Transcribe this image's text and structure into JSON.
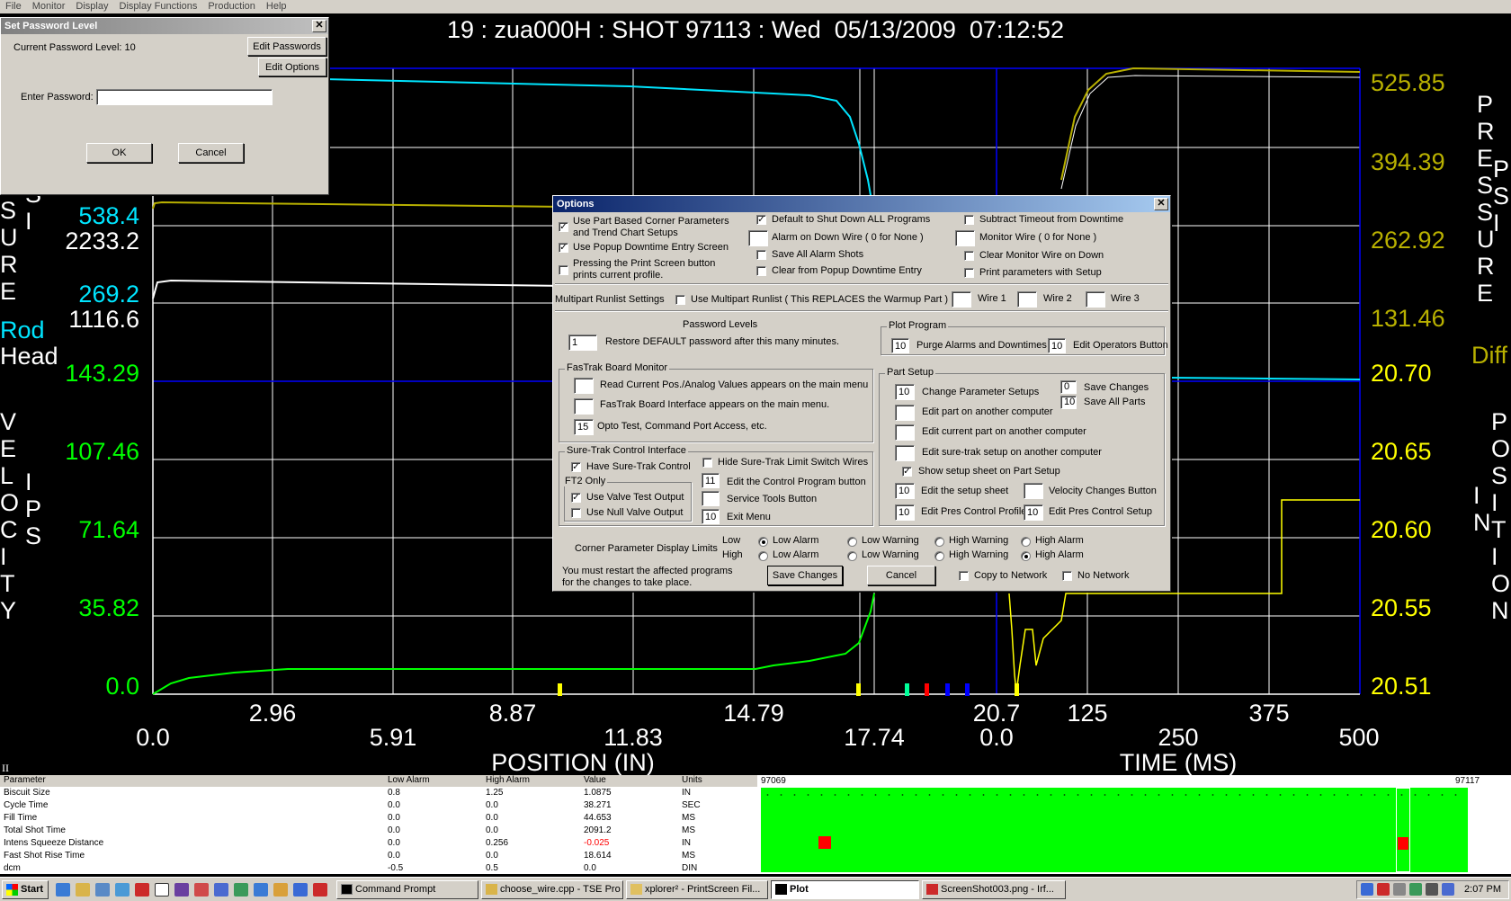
{
  "menu": [
    "File",
    "Monitor",
    "Display",
    "Display Functions",
    "Production",
    "Help"
  ],
  "title": "19 : zua000H : SHOT 97113 : Wed  05/13/2009  07:12:52",
  "left_axis": {
    "pressure_word_visible": "SURE",
    "psi_word_visible": "SI",
    "velocity_word": "VELOCITY",
    "ips_word": "IPS",
    "rod_label": "Rod",
    "head_label": "Head",
    "pressure_values": [
      {
        "text": "538.4",
        "color": "#00e5ff"
      },
      {
        "text": "2233.2",
        "color": "#ffffff"
      },
      {
        "text": "269.2",
        "color": "#00e5ff"
      },
      {
        "text": "1116.6",
        "color": "#ffffff"
      }
    ],
    "velocity_ticks": [
      "143.29",
      "107.46",
      "71.64",
      "35.82",
      "0.0"
    ]
  },
  "right_axis": {
    "pressure_word": "PRESSURE",
    "psi_word": "PSI",
    "pressure_ticks": [
      "525.85",
      "394.39",
      "262.92",
      "131.46"
    ],
    "diff_label": "Diff",
    "position_word": "POSITION",
    "in_word": "IN",
    "position_ticks": [
      "20.70",
      "20.65",
      "20.60",
      "20.55",
      "20.51"
    ]
  },
  "x_axis": {
    "position_ticks_upper": [
      "2.96",
      "8.87",
      "14.79",
      "20.7",
      "125",
      "375"
    ],
    "position_ticks_lower": [
      "0.0",
      "5.91",
      "11.83",
      "17.74",
      "0.0",
      "250",
      "500"
    ],
    "position_label": "POSITION (IN)",
    "time_label": "TIME (MS)"
  },
  "colors": {
    "cyan": "#00e5ff",
    "olive": "#b8b000",
    "green": "#00ff00",
    "yellow": "#ffff00",
    "grid": "#ffffff",
    "axis_blue": "#0000ff",
    "win_gray": "#d4d0c8",
    "title_blue": "#0a246a"
  },
  "password_dialog": {
    "title": "Set Password Level",
    "current_label": "Current Password Level:  10",
    "edit_passwords": "Edit Passwords",
    "edit_options": "Edit Options",
    "enter_label": "Enter Password:",
    "password_value": "",
    "ok": "OK",
    "cancel": "Cancel"
  },
  "options_dialog": {
    "title": "Options",
    "col1": [
      {
        "label": "Use Part Based Corner Parameters",
        "label2": "and Trend Chart Setups",
        "checked": true
      },
      {
        "label": "Use Popup Downtime Entry Screen",
        "checked": true
      },
      {
        "label": "Pressing the Print Screen button",
        "label2": "prints current profile.",
        "checked": false
      }
    ],
    "col2": {
      "shutdown_all": {
        "label": "Default to Shut Down ALL Programs",
        "checked": true
      },
      "alarm_down_wire": {
        "label": "Alarm on Down Wire ( 0 for None )",
        "value": ""
      },
      "save_alarm_shots": {
        "label": "Save All Alarm Shots",
        "checked": false
      },
      "clear_popup": {
        "label": "Clear from Popup Downtime Entry",
        "checked": false
      }
    },
    "col3": {
      "subtract_timeout": {
        "label": "Subtract Timeout from Downtime",
        "checked": false
      },
      "monitor_wire": {
        "label": "Monitor Wire ( 0 for None )",
        "value": ""
      },
      "clear_monitor": {
        "label": "Clear Monitor Wire on Down",
        "checked": false
      },
      "print_params": {
        "label": "Print parameters with Setup",
        "checked": false
      }
    },
    "multipart": {
      "label": "Multipart Runlist Settings",
      "use_label": "Use Multipart Runlist ( This REPLACES the Warmup Part )",
      "checked": false,
      "wires": [
        {
          "label": "Wire 1",
          "value": ""
        },
        {
          "label": "Wire 2",
          "value": ""
        },
        {
          "label": "Wire 3",
          "value": ""
        }
      ]
    },
    "password_levels": {
      "title": "Password Levels",
      "value": "1",
      "label": "Restore DEFAULT password after this many minutes."
    },
    "plot_program": {
      "title": "Plot Program",
      "purge_value": "10",
      "purge_label": "Purge Alarms and Downtimes",
      "ops_value": "10",
      "ops_label": "Edit Operators Button"
    },
    "fastrak": {
      "title": "FasTrak Board Monitor",
      "items": [
        {
          "value": "",
          "label": "Read Current Pos./Analog Values appears on the main menu"
        },
        {
          "value": "",
          "label": "FasTrak Board Interface appears on the main menu."
        },
        {
          "value": "15",
          "label": "Opto Test, Command Port Access, etc."
        }
      ]
    },
    "part_setup": {
      "title": "Part Setup",
      "items": [
        {
          "value": "10",
          "label": "Change Parameter Setups"
        },
        {
          "value": "",
          "label": "Edit part on another computer"
        },
        {
          "value": "",
          "label": "Edit current part on another computer"
        },
        {
          "value": "",
          "label": "Edit sure-trak setup on another computer"
        }
      ],
      "save_changes": {
        "value": "0",
        "label": "Save Changes"
      },
      "save_all": {
        "value": "10",
        "label": "Save All Parts"
      },
      "show_setup": {
        "label": "Show setup sheet on Part Setup",
        "checked": true
      },
      "edit_setup": {
        "value": "10",
        "label": "Edit the setup sheet"
      },
      "velocity_changes": {
        "value": "",
        "label": "Velocity Changes Button"
      },
      "pres_profile": {
        "value": "10",
        "label": "Edit Pres Control Profile"
      },
      "pres_setup": {
        "value": "10",
        "label": "Edit Pres Control Setup"
      }
    },
    "suretrak": {
      "title": "Sure-Trak Control Interface",
      "have": {
        "label": "Have Sure-Trak Control",
        "checked": true
      },
      "hide": {
        "label": "Hide Sure-Trak Limit Switch Wires",
        "checked": false
      },
      "ft2_title": "FT2 Only",
      "valve_test": {
        "label": "Use Valve Test Output",
        "checked": true
      },
      "null_valve": {
        "label": "Use Null Valve Output",
        "checked": false
      },
      "control_prog": {
        "value": "11",
        "label": "Edit the Control Program button"
      },
      "service_tools": {
        "value": "",
        "label": "Service Tools Button"
      },
      "exit_menu": {
        "value": "10",
        "label": "Exit Menu"
      }
    },
    "corner": {
      "label": "Corner Parameter Display Limits",
      "low": "Low",
      "high": "High",
      "options": [
        "Low Alarm",
        "Low Warning",
        "High Warning",
        "High Alarm"
      ],
      "low_selected": "Low Alarm",
      "high_selected": "High Alarm"
    },
    "restart_note": "You must restart the affected programs",
    "restart_note2": "for the changes to take place.",
    "save_btn": "Save Changes",
    "cancel_btn": "Cancel",
    "copy_network": {
      "label": "Copy to Network",
      "checked": false
    },
    "no_network": {
      "label": "No Network",
      "checked": false
    }
  },
  "param_table": {
    "marker": "II",
    "headers": [
      "Parameter",
      "Low Alarm",
      "High Alarm",
      "Value",
      "Units"
    ],
    "rows": [
      [
        "Biscuit Size",
        "0.8",
        "1.25",
        "1.0875",
        "IN"
      ],
      [
        "Cycle Time",
        "0.0",
        "0.0",
        "38.271",
        "SEC"
      ],
      [
        "Fill Time",
        "0.0",
        "0.0",
        "44.653",
        "MS"
      ],
      [
        "Total Shot Time",
        "0.0",
        "0.0",
        "2091.2",
        "MS"
      ],
      [
        "Intens Squeeze Distance",
        "0.0",
        "0.256",
        "-0.025",
        "IN"
      ],
      [
        "Fast Shot Rise Time",
        "0.0",
        "0.0",
        "18.614",
        "MS"
      ],
      [
        "dcm",
        "-0.5",
        "0.5",
        "0.0",
        "DIN"
      ]
    ],
    "alarm_row": 4
  },
  "shot_runs": {
    "start": "97069",
    "end": "97117"
  },
  "taskbar": {
    "start": "Start",
    "tasks": [
      {
        "label": "Command Prompt",
        "active": false
      },
      {
        "label": "choose_wire.cpp - TSE Pro",
        "active": false
      },
      {
        "label": "xplorer² - PrintScreen Fil...",
        "active": false
      },
      {
        "label": "Plot",
        "active": true
      },
      {
        "label": "ScreenShot003.png - Irf...",
        "active": false
      }
    ],
    "clock": "2:07 PM"
  }
}
